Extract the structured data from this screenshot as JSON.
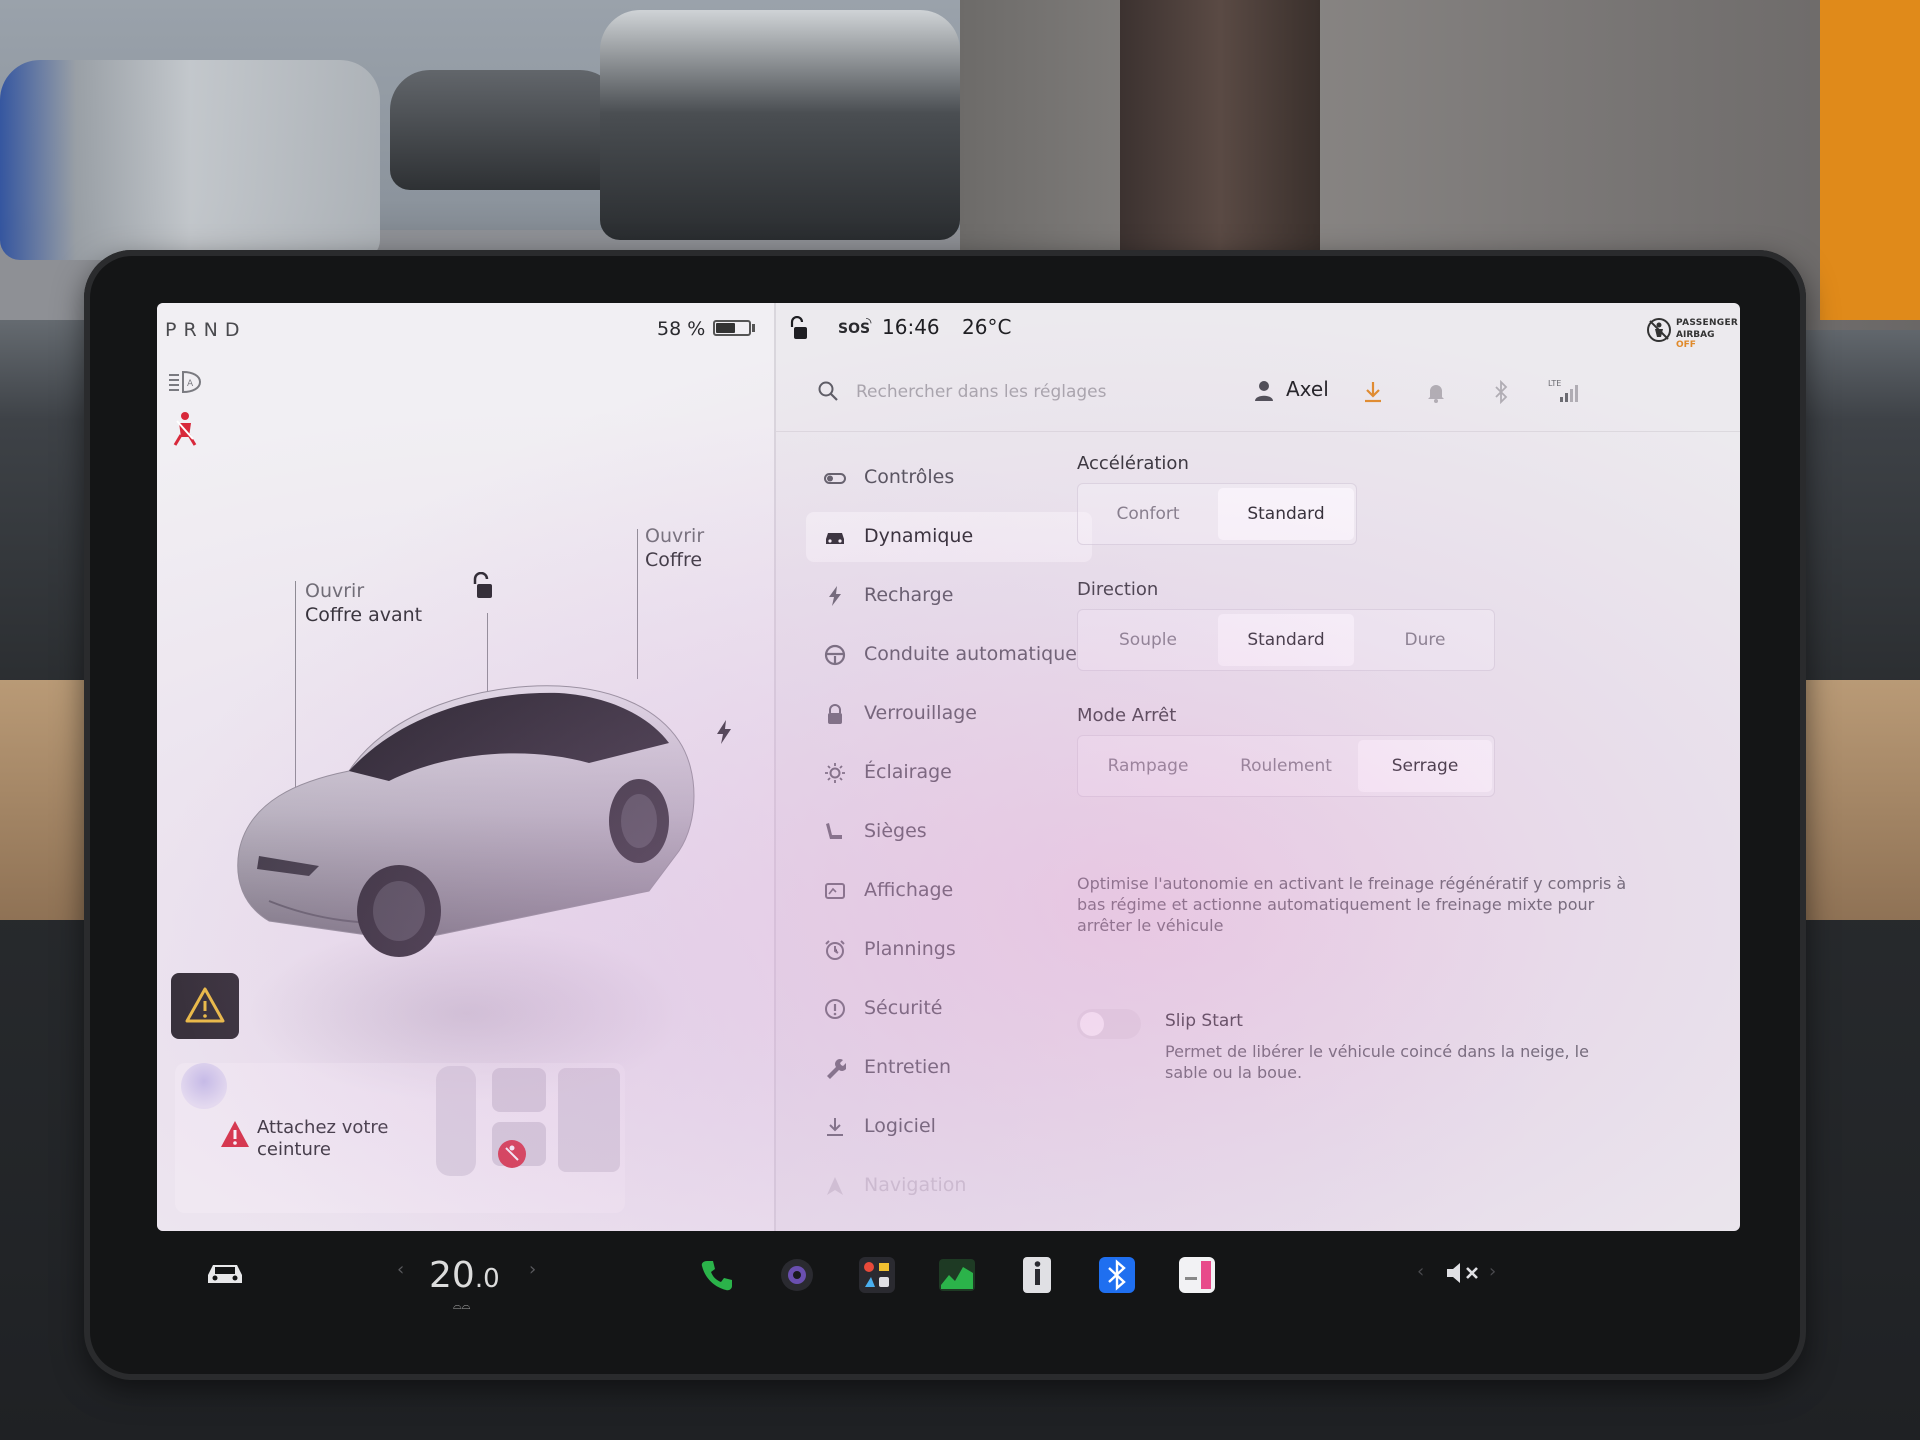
{
  "status": {
    "gear": "PRND",
    "battery_pct": "58 %",
    "battery_level": 0.58,
    "sos": "SOS",
    "time": "16:46",
    "temperature": "26°C",
    "airbag_line1": "PASSENGER",
    "airbag_line2": "AIRBAG",
    "airbag_state": "OFF"
  },
  "vehicle": {
    "frunk_small": "Ouvrir",
    "frunk_big": "Coffre avant",
    "trunk_small": "Ouvrir",
    "trunk_big": "Coffre",
    "alert_line1": "Attachez votre",
    "alert_line2": "ceinture"
  },
  "search": {
    "placeholder": "Rechercher dans les réglages",
    "user_name": "Axel",
    "lte": "LTE"
  },
  "nav": [
    {
      "label": "Contrôles",
      "icon": "toggle-icon"
    },
    {
      "label": "Dynamique",
      "icon": "car-icon"
    },
    {
      "label": "Recharge",
      "icon": "bolt-icon"
    },
    {
      "label": "Conduite automatique",
      "icon": "steering-wheel-icon"
    },
    {
      "label": "Verrouillage",
      "icon": "lock-icon"
    },
    {
      "label": "Éclairage",
      "icon": "sun-icon"
    },
    {
      "label": "Sièges",
      "icon": "seat-icon"
    },
    {
      "label": "Affichage",
      "icon": "display-icon"
    },
    {
      "label": "Plannings",
      "icon": "alarm-clock-icon"
    },
    {
      "label": "Sécurité",
      "icon": "info-circle-icon"
    },
    {
      "label": "Entretien",
      "icon": "wrench-icon"
    },
    {
      "label": "Logiciel",
      "icon": "download-icon"
    },
    {
      "label": "Navigation",
      "icon": "navigation-arrow-icon"
    }
  ],
  "nav_active": "Dynamique",
  "dynamics": {
    "acceleration": {
      "title": "Accélération",
      "options": [
        "Confort",
        "Standard"
      ],
      "selected": "Standard"
    },
    "steering": {
      "title": "Direction",
      "options": [
        "Souple",
        "Standard",
        "Dure"
      ],
      "selected": "Standard"
    },
    "stop_mode": {
      "title": "Mode Arrêt",
      "options": [
        "Rampage",
        "Roulement",
        "Serrage"
      ],
      "selected": "Serrage"
    },
    "stop_mode_description": "Optimise l'autonomie en activant le freinage régénératif y compris à bas régime et actionne automatiquement le freinage mixte pour arrêter le véhicule",
    "slip_start": {
      "title": "Slip Start",
      "enabled": false,
      "description": "Permet de libérer le véhicule coincé dans la neige, le sable ou la boue."
    }
  },
  "dock": {
    "cabin_temp_int": "20",
    "cabin_temp_dec": ".0",
    "apps": [
      "phone-icon",
      "camera-icon",
      "toybox-icon",
      "energy-icon",
      "manual-icon",
      "bluetooth-icon",
      "calendar-icon"
    ],
    "volume_icon": "mute-icon"
  },
  "colors": {
    "accent_orange": "#e08a2a",
    "warning_red": "#d8283a",
    "bluetooth_blue": "#1f6ff0",
    "phone_green": "#2bb34a"
  }
}
